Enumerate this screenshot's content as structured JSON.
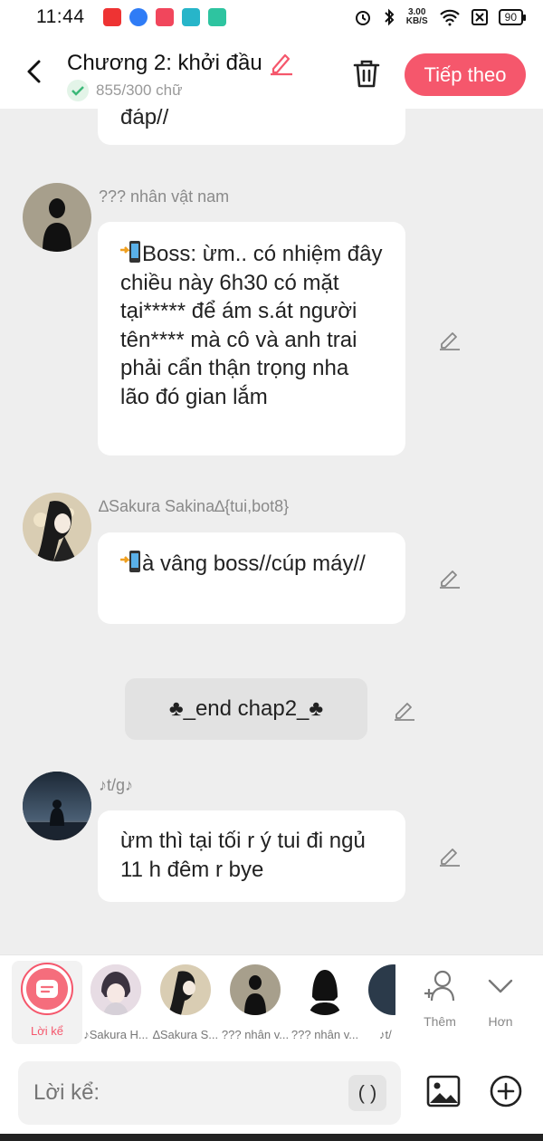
{
  "status_bar": {
    "time": "11:44",
    "speed_value": "3.00",
    "speed_unit": "KB/S",
    "battery": "90",
    "app_icons": [
      "baomoi-icon",
      "messenger-icon",
      "manga-toon-icon",
      "shop-icon",
      "chat-app-icon"
    ]
  },
  "header": {
    "title": "Chương 2: khởi đầu",
    "word_count": "855/300 chữ",
    "next_label": "Tiếp theo"
  },
  "messages": [
    {
      "text": "đáp//"
    },
    {
      "name": "??? nhân vật nam",
      "text": "Boss: ừm.. có nhiệm đây chiều này 6h30 có mặt tại***** để ám s.át người tên**** mà cô và anh trai phải cẩn thận trọng nha lão đó gian lắm",
      "icon": "phone-arrow-icon"
    },
    {
      "name": "∆Sakura Sakina∆{tui,bot8}",
      "text": "à vâng boss//cúp máy//",
      "icon": "phone-arrow-icon"
    },
    {
      "narration": "♣_end chap2_♣"
    },
    {
      "name": "♪t/g♪",
      "text": "ừm thì tại tối r ý tui đi ngủ 11 h đêm r bye"
    }
  ],
  "characters": {
    "narrator_label": "Lời kể",
    "items": [
      {
        "label": "♪Sakura H..."
      },
      {
        "label": "∆Sakura S..."
      },
      {
        "label": "??? nhân v..."
      },
      {
        "label": "??? nhân v..."
      },
      {
        "label": "♪t/"
      }
    ],
    "add_label": "Thêm",
    "more_label": "Hơn"
  },
  "input": {
    "placeholder": "Lời kể:",
    "paren_label": "( )"
  },
  "colors": {
    "accent": "#f5576c",
    "background": "#eeeeee",
    "bubble": "#ffffff"
  }
}
